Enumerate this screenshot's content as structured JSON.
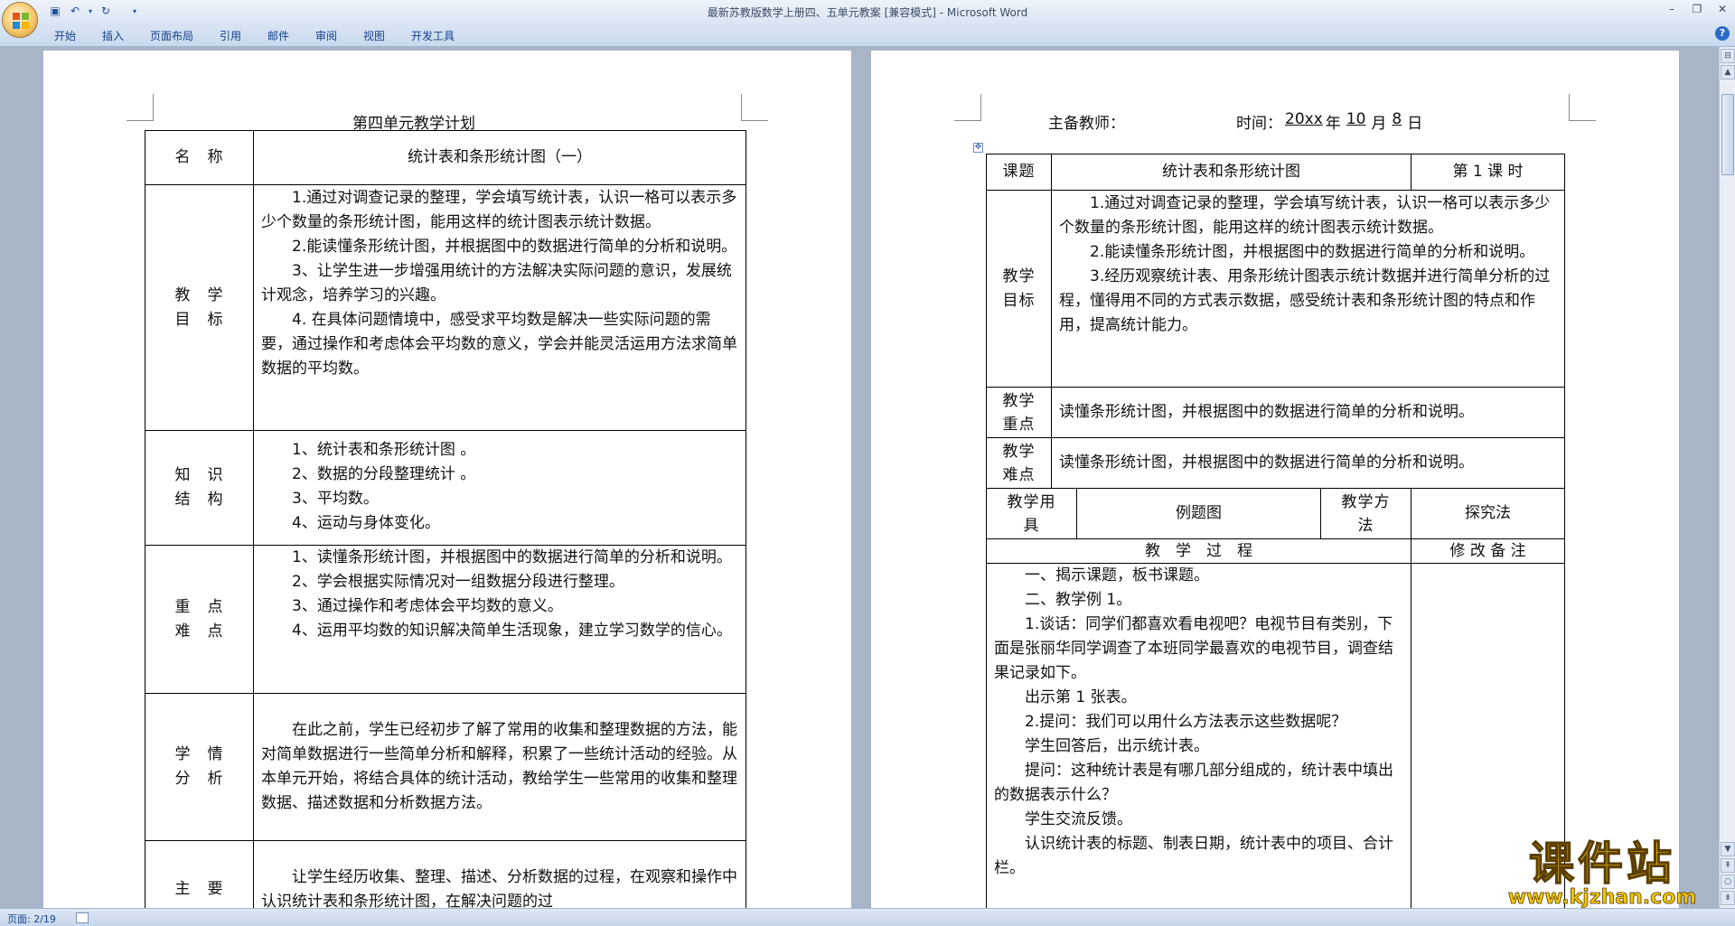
{
  "window": {
    "title": "最新苏教版数学上册四、五单元教案 [兼容模式] - Microsoft Word"
  },
  "ribbon": {
    "tabs": [
      "开始",
      "插入",
      "页面布局",
      "引用",
      "邮件",
      "审阅",
      "视图",
      "开发工具"
    ]
  },
  "page1": {
    "heading": "第四单元教学计划",
    "rows": [
      {
        "label": [
          "名　称"
        ],
        "content": [
          "统计表和条形统计图（一）"
        ]
      },
      {
        "label": [
          "教　学",
          "目　标"
        ],
        "content": [
          "1.通过对调查记录的整理，学会填写统计表，认识一格可以表示多少个数量的条形统计图，能用这样的统计图表示统计数据。",
          "2.能读懂条形统计图，并根据图中的数据进行简单的分析和说明。",
          "3、让学生进一步增强用统计的方法解决实际问题的意识，发展统计观念，培养学习的兴趣。",
          "4. 在具体问题情境中，感受求平均数是解决一些实际问题的需要，通过操作和考虑体会平均数的意义，学会并能灵活运用方法求简单数据的平均数。"
        ]
      },
      {
        "label": [
          "知　识",
          "结　构"
        ],
        "content": [
          "1、统计表和条形统计图 。",
          "2、数据的分段整理统计 。",
          "3、平均数。",
          "4、运动与身体变化。"
        ]
      },
      {
        "label": [
          "重　点",
          "难　点"
        ],
        "content": [
          "1、读懂条形统计图，并根据图中的数据进行简单的分析和说明。",
          "2、学会根据实际情况对一组数据分段进行整理。",
          "3、通过操作和考虑体会平均数的意义。",
          "4、运用平均数的知识解决简单生活现象，建立学习数学的信心。"
        ]
      },
      {
        "label": [
          "学　情",
          "分　析"
        ],
        "content": [
          "在此之前，学生已经初步了解了常用的收集和整理数据的方法，能对简单数据进行一些简单分析和解释，积累了一些统计活动的经验。从本单元开始，将结合具体的统计活动，教给学生一些常用的收集和整理数据、描述数据和分析数据方法。"
        ]
      },
      {
        "label": [
          "主　要"
        ],
        "content": [
          "让学生经历收集、整理、描述、分析数据的过程，在观察和操作中认识统计表和条形统计图，在解决问题的过"
        ]
      }
    ]
  },
  "page2": {
    "teacher_label": "主备教师：",
    "time_label": "时间：",
    "year": "20xx",
    "year_unit": "年",
    "month": "10",
    "month_unit": "月",
    "day": "8",
    "day_unit": "日",
    "topic_label": "课题",
    "topic": "统计表和条形统计图",
    "lesson": "第 1 课 时",
    "goal_label": [
      "教学",
      "目标"
    ],
    "goals": [
      "1.通过对调查记录的整理，学会填写统计表，认识一格可以表示多少个数量的条形统计图，能用这样的统计图表示统计数据。",
      "2.能读懂条形统计图，并根据图中的数据进行简单的分析和说明。",
      "3.经历观察统计表、用条形统计图表示统计数据并进行简单分析的过程，懂得用不同的方式表示数据，感受统计表和条形统计图的特点和作用，提高统计能力。"
    ],
    "key_label": [
      "教学",
      "重点"
    ],
    "key_point": "读懂条形统计图，并根据图中的数据进行简单的分析和说明。",
    "diff_label": [
      "教学",
      "难点"
    ],
    "difficulty": "读懂条形统计图，并根据图中的数据进行简单的分析和说明。",
    "tools_label": [
      "教学用",
      "具"
    ],
    "tools": "例题图",
    "method_label": [
      "教学方",
      "法"
    ],
    "method": "探究法",
    "process_label": "教　学　过　程",
    "notes_label": "修 改 备 注",
    "process": [
      "一、揭示课题，板书课题。",
      "二、教学例 1。",
      "1.谈话：同学们都喜欢看电视吧？电视节目有类别，下面是张丽华同学调查了本班同学最喜欢的电视节目，调查结果记录如下。",
      "出示第 1 张表。",
      "2.提问：我们可以用什么方法表示这些数据呢？",
      "学生回答后，出示统计表。",
      "提问：这种统计表是有哪几部分组成的，统计表中填出的数据表示什么？",
      "学生交流反馈。",
      "认识统计表的标题、制表日期，统计表中的项目、合计栏。"
    ]
  },
  "status": {
    "page": "页面: 2/19"
  },
  "watermark": {
    "text": "课件站",
    "url": "www.kjzhan.com"
  }
}
